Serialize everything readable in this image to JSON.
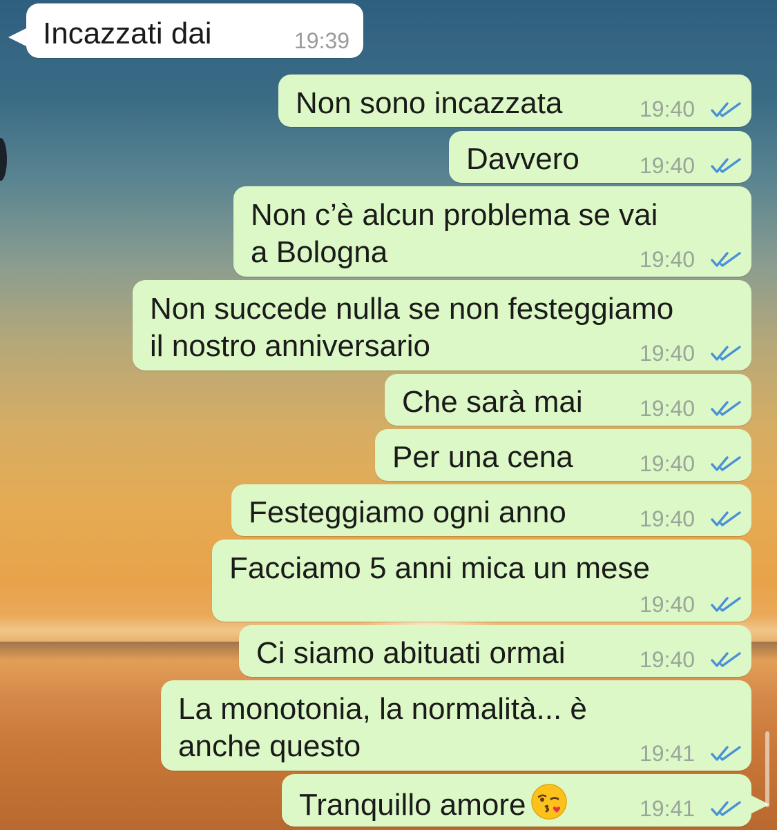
{
  "conversation": {
    "incoming": [
      {
        "text": "Incazzati dai",
        "time": "19:39"
      }
    ],
    "outgoing": [
      {
        "lines": [
          "Non sono incazzata"
        ],
        "time": "19:40",
        "status": "read"
      },
      {
        "lines": [
          "Davvero"
        ],
        "time": "19:40",
        "status": "read"
      },
      {
        "lines": [
          "Non c’è alcun problema se vai",
          "a Bologna"
        ],
        "time": "19:40",
        "status": "read"
      },
      {
        "lines": [
          "Non succede nulla se non festeggiamo",
          "il nostro anniversario"
        ],
        "time": "19:40",
        "status": "read"
      },
      {
        "lines": [
          "Che sarà mai"
        ],
        "time": "19:40",
        "status": "read"
      },
      {
        "lines": [
          "Per una cena"
        ],
        "time": "19:40",
        "status": "read"
      },
      {
        "lines": [
          "Festeggiamo ogni anno"
        ],
        "time": "19:40",
        "status": "read"
      },
      {
        "lines": [
          "Facciamo 5 anni mica un mese"
        ],
        "time": "19:40",
        "status": "read"
      },
      {
        "lines": [
          "Ci siamo abituati ormai"
        ],
        "time": "19:40",
        "status": "read"
      },
      {
        "lines": [
          "La monotonia, la normalità... è",
          "anche questo"
        ],
        "time": "19:41",
        "status": "read"
      },
      {
        "lines": [
          "Tranquillo amore"
        ],
        "time": "19:41",
        "status": "read",
        "emoji": "kissing-face-with-heart"
      }
    ]
  },
  "colors": {
    "outgoing_bubble": "#dcf8c6",
    "incoming_bubble": "#ffffff",
    "read_ticks": "#4a90d9",
    "timestamp": "#9aa59a"
  },
  "icons": {
    "read_receipt": "double-check-icon",
    "emoji": "kissing-face-emoji-icon"
  }
}
